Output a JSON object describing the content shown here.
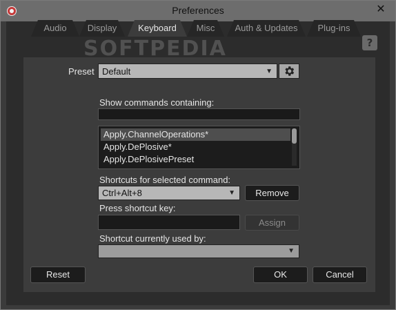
{
  "window": {
    "title": "Preferences",
    "close_glyph": "✕"
  },
  "tabs": [
    {
      "label": "Audio",
      "active": false
    },
    {
      "label": "Display",
      "active": false
    },
    {
      "label": "Keyboard",
      "active": true
    },
    {
      "label": "Misc",
      "active": false
    },
    {
      "label": "Auth & Updates",
      "active": false
    },
    {
      "label": "Plug-ins",
      "active": false
    }
  ],
  "help_label": "?",
  "watermark": "SOFTPEDIA",
  "preset": {
    "label": "Preset",
    "value": "Default"
  },
  "commands": {
    "label": "Show commands containing:",
    "filter_value": "",
    "items": [
      {
        "label": "Apply.ChannelOperations*",
        "selected": true
      },
      {
        "label": "Apply.DePlosive*",
        "selected": false
      },
      {
        "label": "Apply.DePlosivePreset",
        "selected": false
      }
    ]
  },
  "shortcuts": {
    "label": "Shortcuts for selected command:",
    "value": "Ctrl+Alt+8",
    "remove_label": "Remove"
  },
  "press_key": {
    "label": "Press shortcut key:",
    "value": "",
    "assign_label": "Assign"
  },
  "used_by": {
    "label": "Shortcut currently used by:",
    "value": ""
  },
  "footer": {
    "reset_label": "Reset",
    "ok_label": "OK",
    "cancel_label": "Cancel"
  }
}
